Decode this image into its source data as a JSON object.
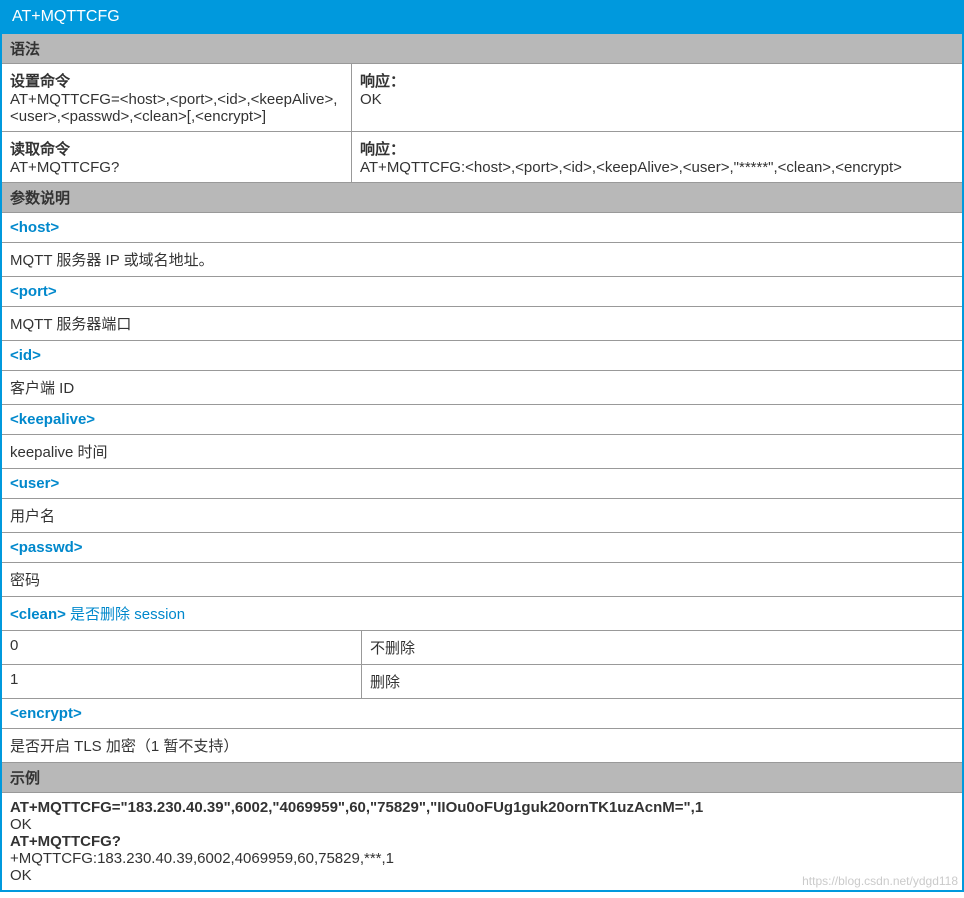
{
  "title": "AT+MQTTCFG",
  "sections": {
    "syntax_header": "语法",
    "set_cmd_label": "设置命令",
    "set_cmd_value": "AT+MQTTCFG=<host>,<port>,<id>,<keepAlive>,<user>,<passwd>,<clean>[,<encrypt>]",
    "set_resp_label": "响应：",
    "set_resp_value": "OK",
    "read_cmd_label": "读取命令",
    "read_cmd_value": "AT+MQTTCFG?",
    "read_resp_label": "响应：",
    "read_resp_value": "AT+MQTTCFG:<host>,<port>,<id>,<keepAlive>,<user>,\"*****\",<clean>,<encrypt>",
    "params_header": "参数说明",
    "params": {
      "host_name": "<host>",
      "host_desc": "MQTT 服务器 IP 或域名地址。",
      "port_name": "<port>",
      "port_desc": "MQTT 服务器端口",
      "id_name": "<id>",
      "id_desc": "客户端 ID",
      "keepalive_name": "<keepalive>",
      "keepalive_desc": "keepalive 时间",
      "user_name": "<user>",
      "user_desc": "用户名",
      "passwd_name": "<passwd>",
      "passwd_desc": "密码",
      "clean_name": "<clean>",
      "clean_extra": "  是否删除 session",
      "clean_opt0_k": "0",
      "clean_opt0_v": "不删除",
      "clean_opt1_k": "1",
      "clean_opt1_v": "删除",
      "encrypt_name": "<encrypt>",
      "encrypt_desc": "是否开启 TLS 加密（1 暂不支持）"
    },
    "example_header": "示例",
    "example": {
      "line1": "AT+MQTTCFG=\"183.230.40.39\",6002,\"4069959\",60,\"75829\",\"IIOu0oFUg1guk20ornTK1uzAcnM=\",1",
      "line2": "OK",
      "line3": "AT+MQTTCFG?",
      "line4": "+MQTTCFG:183.230.40.39,6002,4069959,60,75829,***,1",
      "line5": "OK"
    }
  },
  "watermark": "https://blog.csdn.net/ydgd118"
}
